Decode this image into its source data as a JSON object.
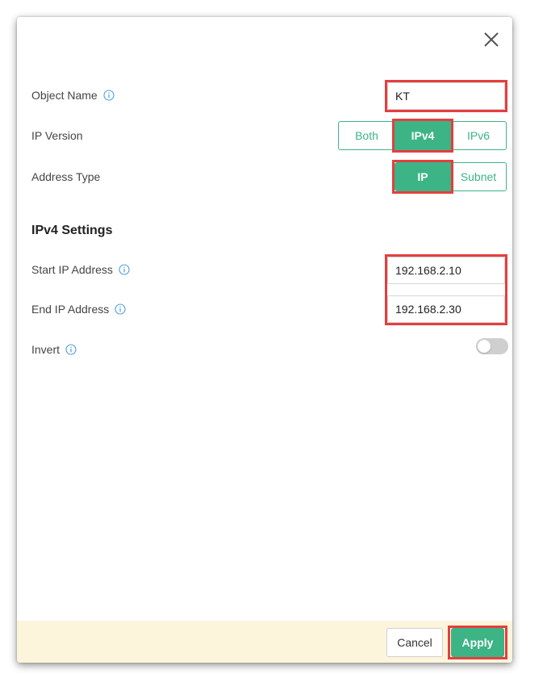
{
  "dialog": {
    "close_label": "close"
  },
  "fields": {
    "object_name": {
      "label": "Object Name",
      "value": "KT"
    },
    "ip_version": {
      "label": "IP Version",
      "options": [
        "Both",
        "IPv4",
        "IPv6"
      ],
      "selected": "IPv4"
    },
    "address_type": {
      "label": "Address Type",
      "options": [
        "IP",
        "Subnet"
      ],
      "selected": "IP"
    }
  },
  "ipv4_settings": {
    "title": "IPv4 Settings",
    "start_ip": {
      "label": "Start IP Address",
      "value": "192.168.2.10"
    },
    "end_ip": {
      "label": "End IP Address",
      "value": "192.168.2.30"
    },
    "invert": {
      "label": "Invert",
      "enabled": false
    }
  },
  "footer": {
    "cancel_label": "Cancel",
    "apply_label": "Apply"
  },
  "colors": {
    "accent": "#3cb486",
    "highlight": "#e53e3e",
    "footer_bg": "#fdf4dc",
    "info_icon": "#4a9fd8"
  },
  "icons": {
    "close": "close-icon",
    "info": "info-icon"
  }
}
